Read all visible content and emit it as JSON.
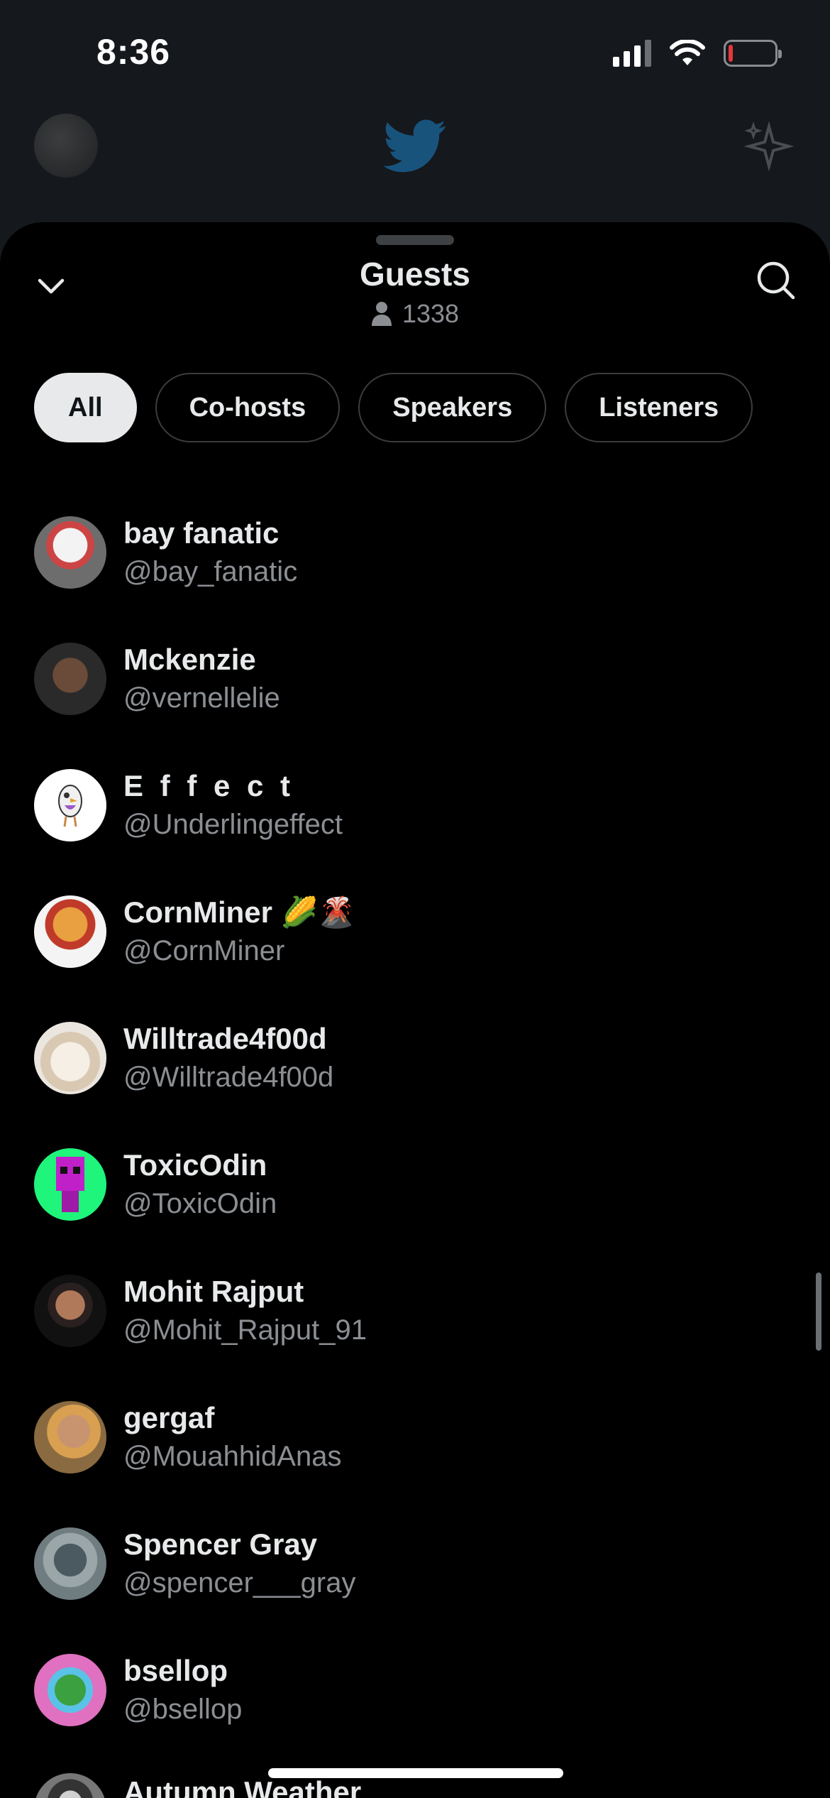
{
  "status_bar": {
    "time": "8:36"
  },
  "sheet": {
    "title": "Guests",
    "listener_count": "1338"
  },
  "filters": [
    "All",
    "Co-hosts",
    "Speakers",
    "Listeners"
  ],
  "active_filter": "All",
  "guests": [
    {
      "name": "bay fanatic",
      "handle": "@bay_fanatic",
      "avatar_color": "#c9c9c9",
      "avatar_glyph": ""
    },
    {
      "name": "Mckenzie",
      "handle": "@vernellelie",
      "avatar_color": "#3b3b3b",
      "avatar_glyph": ""
    },
    {
      "name": "E f f e c t",
      "handle": "@Underlingeffect",
      "avatar_color": "#ffffff",
      "avatar_glyph": ""
    },
    {
      "name": "CornMiner 🌽🌋",
      "handle": "@CornMiner",
      "avatar_color": "#f4f4f4",
      "avatar_glyph": ""
    },
    {
      "name": "Willtrade4f00d",
      "handle": "@Willtrade4f00d",
      "avatar_color": "#e8e4dc",
      "avatar_glyph": ""
    },
    {
      "name": "ToxicOdin",
      "handle": "@ToxicOdin",
      "avatar_color": "#1ef57a",
      "avatar_glyph": ""
    },
    {
      "name": "Mohit Rajput",
      "handle": "@Mohit_Rajput_91",
      "avatar_color": "#1a1a1a",
      "avatar_glyph": ""
    },
    {
      "name": "gergaf",
      "handle": "@MouahhidAnas",
      "avatar_color": "#c48a4a",
      "avatar_glyph": ""
    },
    {
      "name": "Spencer Gray",
      "handle": "@spencer___gray",
      "avatar_color": "#8e9aa0",
      "avatar_glyph": ""
    },
    {
      "name": "bsellop",
      "handle": "@bsellop",
      "avatar_color": "#5bc2e7",
      "avatar_glyph": ""
    },
    {
      "name": "Autumn Weather",
      "handle": "",
      "avatar_color": "#555555",
      "avatar_glyph": ""
    }
  ],
  "icons": {
    "collapse": "chevron-down-icon",
    "search": "search-icon",
    "person": "person-icon"
  },
  "colors": {
    "background": "#000000",
    "text_primary": "#e7e9ea",
    "text_secondary": "#8b8f93",
    "chip_active_bg": "#e7e9ea"
  }
}
